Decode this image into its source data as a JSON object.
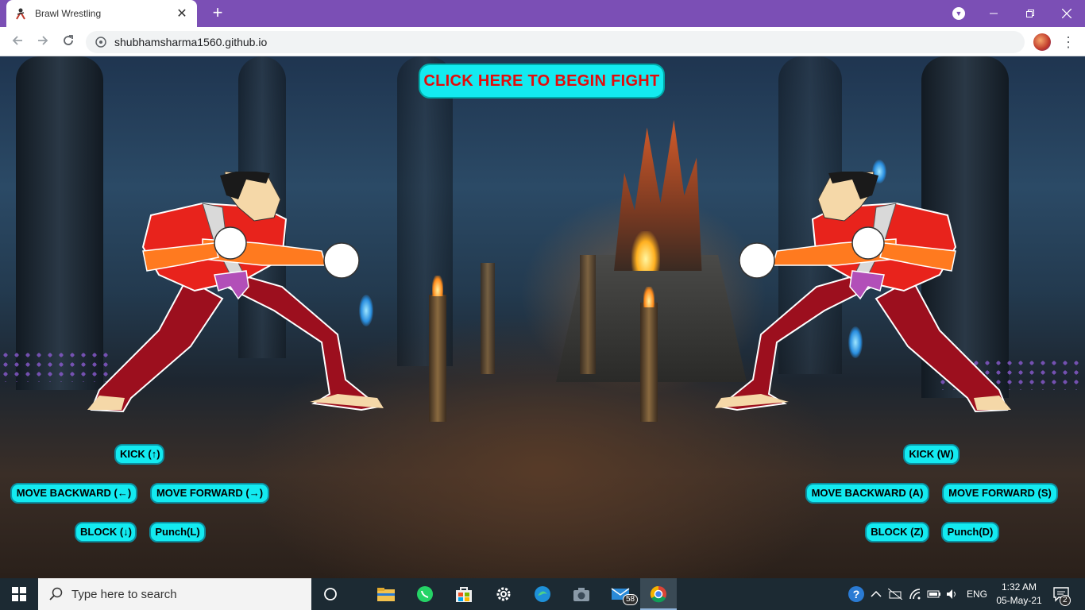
{
  "browser": {
    "tab_title": "Brawl Wrestling",
    "url": "shubhamsharma1560.github.io",
    "new_tab_symbol": "+",
    "close_tab_symbol": "✕",
    "accent_color": "#7b4fb5"
  },
  "game": {
    "title": "Brawl Wrestling",
    "start_button_label": "CLICK HERE TO BEGIN FIGHT",
    "button_color": "#13eaf0",
    "start_text_color": "#e30b0b",
    "player1_controls": {
      "kick": "KICK (↑)",
      "move_backward": "MOVE BACKWARD (←)",
      "move_forward": "MOVE FORWARD (→)",
      "block": "BLOCK (↓)",
      "punch": "Punch(L)"
    },
    "player2_controls": {
      "kick": "KICK (W)",
      "move_backward": "MOVE BACKWARD (A)",
      "move_forward": "MOVE FORWARD (S)",
      "block": "BLOCK (Z)",
      "punch": "Punch(D)"
    },
    "fighter_colors": {
      "shirt": "#e8231c",
      "sleeve": "#ff7a1f",
      "pants": "#9c0f1e",
      "belt": "#b24fb8",
      "skin": "#f5d8a8",
      "hair": "#1a1a1a"
    }
  },
  "taskbar": {
    "search_placeholder": "Type here to search",
    "mail_badge": "58",
    "language": "ENG",
    "time": "1:32 AM",
    "date": "05-May-21",
    "notification_count": "2",
    "pinned_apps": [
      "task-view",
      "file-explorer",
      "whatsapp",
      "store",
      "settings",
      "edge",
      "camera",
      "mail",
      "chrome"
    ]
  }
}
